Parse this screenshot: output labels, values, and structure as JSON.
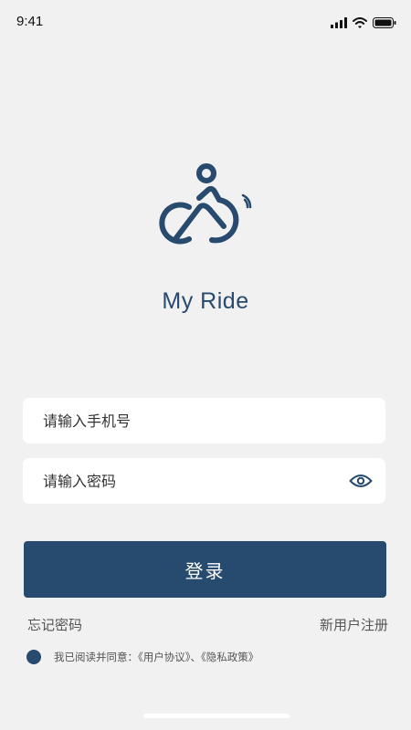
{
  "status": {
    "time": "9:41"
  },
  "app": {
    "name": "My Ride"
  },
  "form": {
    "phone_placeholder": "请输入手机号",
    "password_placeholder": "请输入密码",
    "login_label": "登录"
  },
  "links": {
    "forgot_password": "忘记密码",
    "register": "新用户注册"
  },
  "agreement": {
    "checked": true,
    "text": "我已阅读并同意：《用户协议》、《隐私政策》"
  },
  "colors": {
    "primary": "#264b6f",
    "background": "#f1f1f1",
    "field": "#ffffff"
  },
  "icons": {
    "logo": "cyclist-icon",
    "password_toggle": "eye-icon",
    "status": [
      "signal-icon",
      "wifi-icon",
      "battery-icon"
    ]
  }
}
